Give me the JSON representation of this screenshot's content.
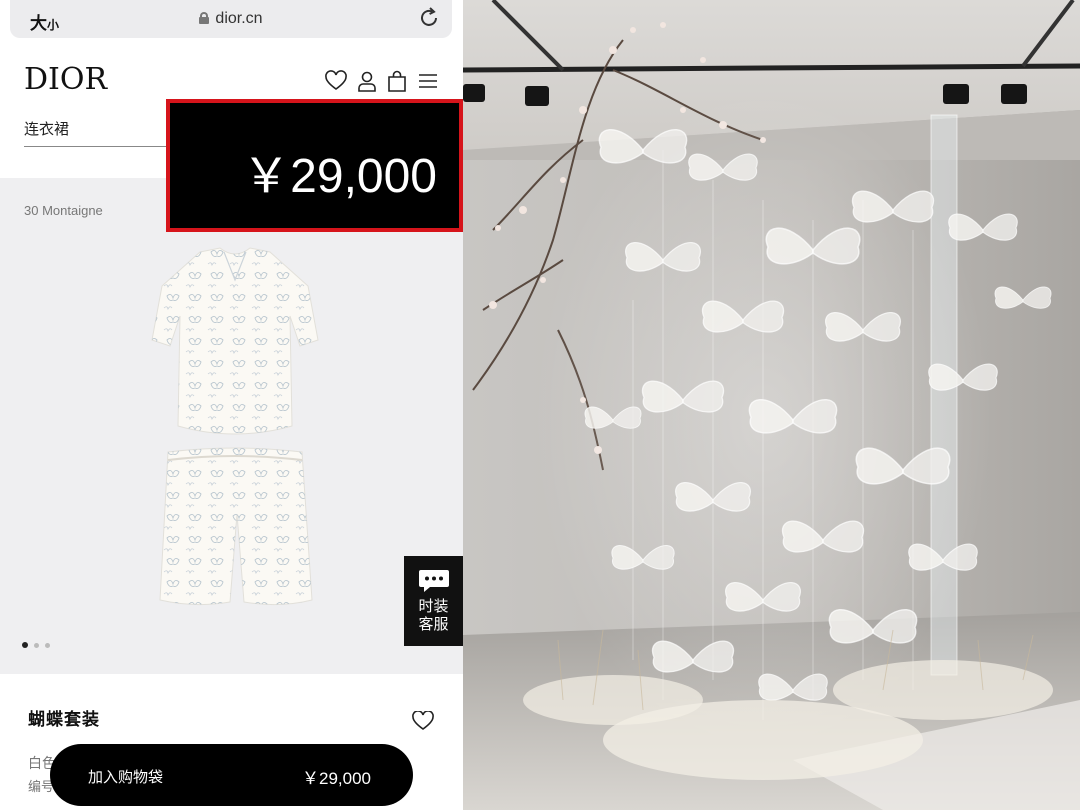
{
  "browser": {
    "text_size_large": "大",
    "text_size_small": "小",
    "url": "dior.cn",
    "lock_icon": "lock-icon",
    "reload_icon": "reload-icon"
  },
  "header": {
    "logo": "DIOR",
    "icons": [
      "heart-icon",
      "account-icon",
      "shopping-bag-icon",
      "menu-icon"
    ]
  },
  "breadcrumb": {
    "category": "连衣裙"
  },
  "price_highlight": {
    "price": "￥29,000",
    "border_color": "#d6141b"
  },
  "product": {
    "collection": "30 Montaigne",
    "name": "蝴蝶套装",
    "color_text": "白色",
    "sku_text": "编号",
    "image_count": 3,
    "active_image": 1
  },
  "chat": {
    "label": "时装客服",
    "icon": "chat-bubble-icon"
  },
  "add_to_bag": {
    "label": "加入购物袋",
    "price": "￥29,000"
  },
  "photo": {
    "subject": "butterfly-installation-photo"
  },
  "colors": {
    "brand": "#000000",
    "highlight_border": "#d6141b",
    "product_bg": "#efeff1",
    "browser_bar": "#ececee"
  }
}
